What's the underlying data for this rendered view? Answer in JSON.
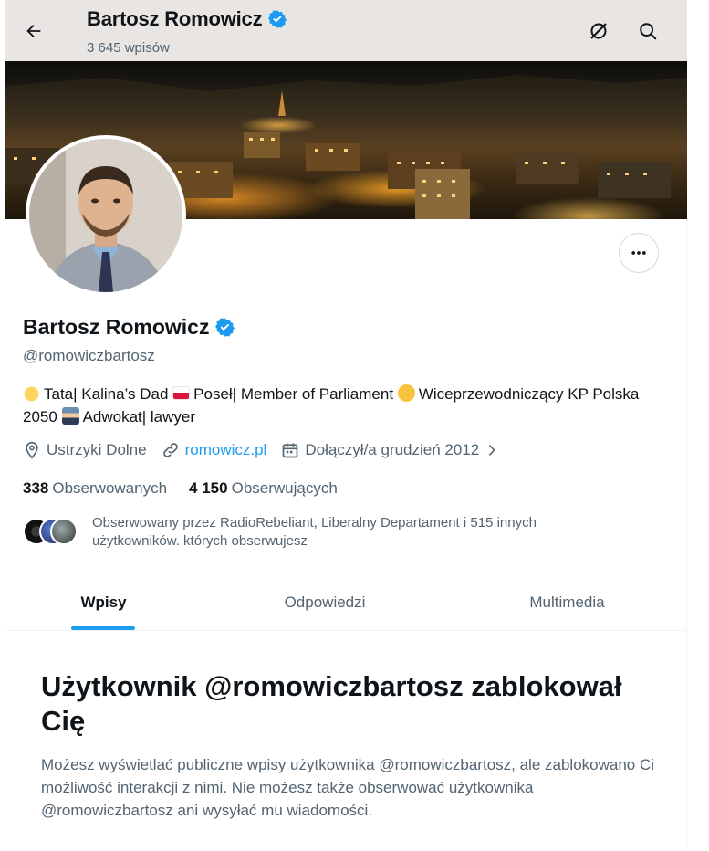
{
  "header": {
    "name": "Bartosz Romowicz",
    "posts_count": "3 645 wpisów"
  },
  "profile": {
    "name": "Bartosz Romowicz",
    "handle": "@romowiczbartosz",
    "bio": {
      "seg1": "Tata| Kalina’s Dad",
      "seg2": "Poseł| Member of Parliament",
      "seg3": "Wiceprzewodniczący KP Polska 2050",
      "seg4": "Adwokat| lawyer"
    },
    "location": "Ustrzyki Dolne",
    "website": "romowicz.pl",
    "joined": "Dołączył/a grudzień 2012",
    "following_count": "338",
    "following_label": "Obserwowanych",
    "followers_count": "4 150",
    "followers_label": "Obserwujących",
    "followed_by": "Obserwowany przez RadioRebeliant, Liberalny Departament i 515 innych użytkowników. których obserwujesz"
  },
  "tabs": [
    {
      "label": "Wpisy"
    },
    {
      "label": "Odpowiedzi"
    },
    {
      "label": "Multimedia"
    }
  ],
  "blocked": {
    "title": "Użytkownik @romowiczbartosz zablokował Cię",
    "message": "Możesz wyświetlać publiczne wpisy użytkownika @romowiczbartosz, ale zablokowano Ci możliwość interakcji z nimi. Nie możesz także obserwować użytkownika @romowiczbartosz ani wysyłać mu wiadomości."
  },
  "colors": {
    "accent": "#1d9bf0",
    "text_primary": "#0f1419",
    "text_secondary": "#536471",
    "header_bg": "#e8e5e3"
  },
  "icons": {
    "back": "arrow-left-icon",
    "verified": "verified-badge-icon",
    "grok": "grok-icon",
    "search": "search-icon",
    "more": "more-dots-icon",
    "location": "location-pin-icon",
    "link": "link-icon",
    "calendar": "calendar-icon",
    "chevron": "chevron-right-icon"
  }
}
